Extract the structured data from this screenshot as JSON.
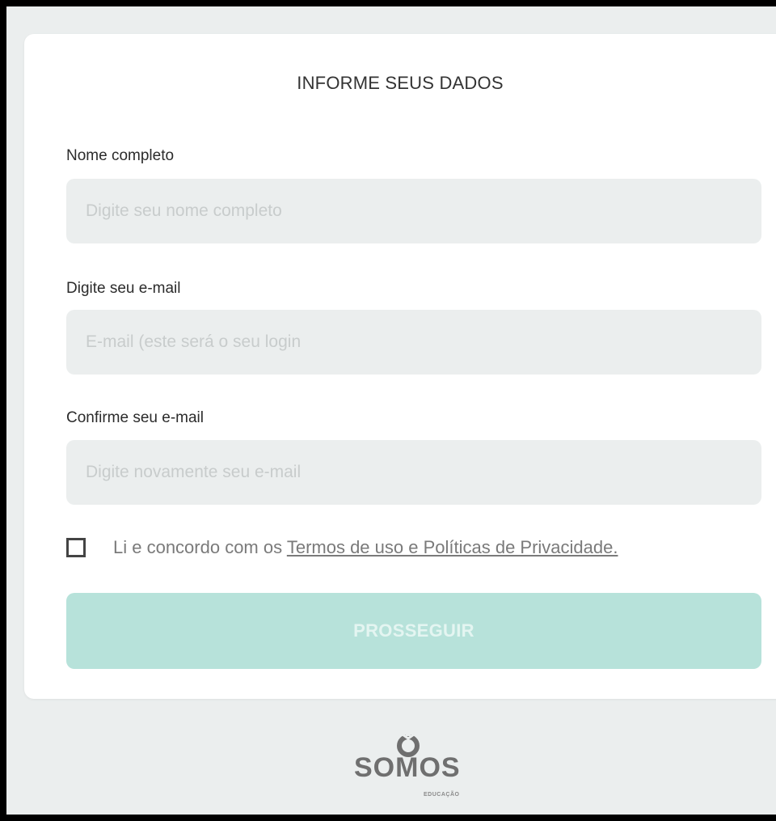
{
  "form": {
    "title": "INFORME SEUS DADOS",
    "fields": [
      {
        "label": "Nome completo",
        "placeholder": "Digite seu nome completo"
      },
      {
        "label": "Digite seu e-mail",
        "placeholder": "E-mail (este será o seu login"
      },
      {
        "label": "Confirme seu e-mail",
        "placeholder": "Digite novamente seu e-mail"
      }
    ],
    "terms_prefix": "Li e concordo com os ",
    "terms_link": "Termos de uso e Políticas de Privacidade.",
    "terms_checked": false,
    "submit_label": "PROSSEGUIR"
  },
  "footer": {
    "logo_text": "SOMOS",
    "logo_subtext": "EDUCAÇÃO",
    "logo_icon": "somos-logo-icon"
  },
  "colors": {
    "background": "#ebeeee",
    "card": "#ffffff",
    "input_bg": "#ebeeee",
    "button_disabled": "#b7e2da",
    "button_text": "#e4f5f1",
    "placeholder": "#c8cccc"
  }
}
